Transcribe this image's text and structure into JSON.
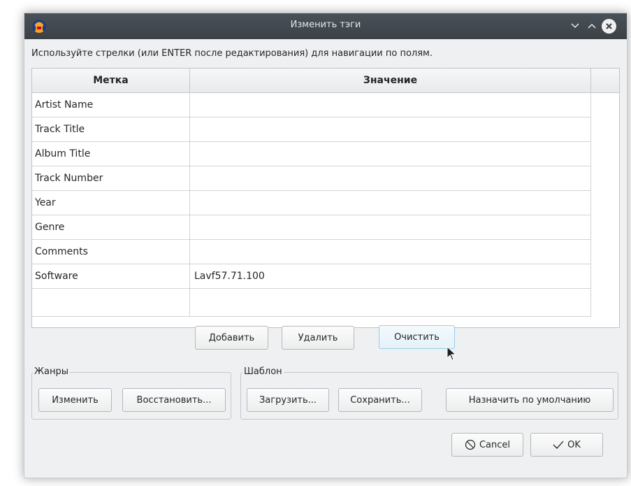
{
  "window": {
    "title": "Изменить тэги"
  },
  "hint": "Используйте стрелки (или ENTER после редактирования) для навигации по полям.",
  "table": {
    "headers": {
      "label": "Метка",
      "value": "Значение"
    },
    "rows": [
      {
        "label": "Artist Name",
        "value": ""
      },
      {
        "label": "Track Title",
        "value": ""
      },
      {
        "label": "Album Title",
        "value": ""
      },
      {
        "label": "Track Number",
        "value": ""
      },
      {
        "label": "Year",
        "value": ""
      },
      {
        "label": "Genre",
        "value": ""
      },
      {
        "label": "Comments",
        "value": ""
      },
      {
        "label": "Software",
        "value": "Lavf57.71.100"
      },
      {
        "label": "",
        "value": ""
      }
    ]
  },
  "buttons": {
    "add": "Добавить",
    "remove": "Удалить",
    "clear": "Очистить"
  },
  "genres": {
    "title": "Жанры",
    "edit": "Изменить",
    "reset": "Восстановить..."
  },
  "template": {
    "title": "Шаблон",
    "load": "Загрузить...",
    "save": "Сохранить...",
    "set_default": "Назначить по умолчанию"
  },
  "footer": {
    "cancel": "Cancel",
    "ok": "OK",
    "cancel_icon": "cancel-circle-icon",
    "ok_icon": "checkmark-icon"
  },
  "colors": {
    "titlebar": "#3b4147",
    "focus_border": "#93cee9"
  }
}
